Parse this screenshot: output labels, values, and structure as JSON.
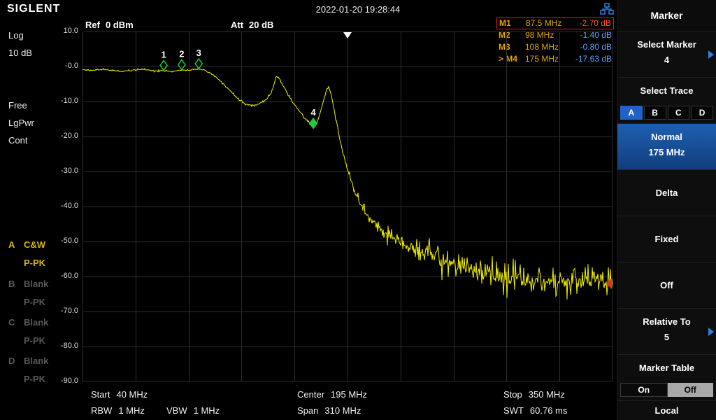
{
  "header": {
    "logo": "SIGLENT",
    "datetime": "2022-01-20 19:28:44"
  },
  "top_info": {
    "ref_label": "Ref",
    "ref_value": "0 dBm",
    "att_label": "Att",
    "att_value": "20 dB"
  },
  "marker_table": {
    "rows": [
      {
        "id": "M1",
        "freq": "87.5 MHz",
        "amp": "-2.70 dB",
        "highlight": true
      },
      {
        "id": "M2",
        "freq": "98 MHz",
        "amp": "-1.40 dB",
        "highlight": false
      },
      {
        "id": "M3",
        "freq": "108 MHz",
        "amp": "-0.80 dB",
        "highlight": false
      },
      {
        "id": "> M4",
        "freq": "175 MHz",
        "amp": "-17.63 dB",
        "highlight": false
      }
    ]
  },
  "left_panel": {
    "log": "Log",
    "scale": "10 dB",
    "free": "Free",
    "lgpwr": "LgPwr",
    "cont": "Cont",
    "traces": [
      {
        "id": "A",
        "mode": "C&W",
        "det": "P-PK",
        "active": true
      },
      {
        "id": "B",
        "mode": "Blank",
        "det": "P-PK",
        "active": false
      },
      {
        "id": "C",
        "mode": "Blank",
        "det": "P-PK",
        "active": false
      },
      {
        "id": "D",
        "mode": "Blank",
        "det": "P-PK",
        "active": false
      }
    ]
  },
  "footer": {
    "start": {
      "label": "Start",
      "value": "40 MHz"
    },
    "center": {
      "label": "Center",
      "value": "195 MHz"
    },
    "stop": {
      "label": "Stop",
      "value": "350 MHz"
    },
    "rbw": {
      "label": "RBW",
      "value": "1 MHz"
    },
    "vbw": {
      "label": "VBW",
      "value": "1 MHz"
    },
    "span": {
      "label": "Span",
      "value": "310 MHz"
    },
    "swt": {
      "label": "SWT",
      "value": "60.76 ms"
    }
  },
  "menu": {
    "title": "Marker",
    "select_marker": {
      "label": "Select Marker",
      "value": "4"
    },
    "select_trace": {
      "label": "Select Trace",
      "tabs": [
        "A",
        "B",
        "C",
        "D"
      ],
      "active": "A"
    },
    "normal": {
      "label": "Normal",
      "value": "175 MHz"
    },
    "delta": "Delta",
    "fixed": "Fixed",
    "off": "Off",
    "relative_to": {
      "label": "Relative To",
      "value": "5"
    },
    "marker_table": {
      "label": "Marker Table",
      "on": "On",
      "off": "Off",
      "state": "Off"
    },
    "local": "Local"
  },
  "colors": {
    "accent_blue": "#2f7fe0",
    "menu_blue": "#1d5fb2",
    "trace_yellow": "#f0f000",
    "marker_green": "#1ecc3c",
    "alert_red": "#d81f14",
    "label_yellow": "#e0a300"
  },
  "chart_data": {
    "type": "line",
    "title": "Spectrum trace A",
    "x_unit": "MHz",
    "y_unit": "dBm",
    "x_range": [
      40,
      350
    ],
    "y_range": [
      -90,
      10
    ],
    "ref_level_dbm": 0,
    "scale_db_per_div": 10,
    "y_tick_labels": [
      "10.0",
      "-0.0",
      "-10.0",
      "-20.0",
      "-30.0",
      "-40.0",
      "-50.0",
      "-60.0",
      "-70.0",
      "-80.0",
      "-90.0"
    ],
    "trace_color": "#f0f000",
    "grid_color": "#2d2d2d",
    "marker_color": "#1ecc3c",
    "noise_seed": 1234567,
    "center_indicator_freq": 195,
    "edge_marker_db": -62,
    "keypoints": [
      [
        40,
        -0.9
      ],
      [
        46,
        -1.1
      ],
      [
        52,
        -0.8
      ],
      [
        58,
        -1.2
      ],
      [
        64,
        -1.4
      ],
      [
        70,
        -1.0
      ],
      [
        76,
        -0.8
      ],
      [
        82,
        -1.3
      ],
      [
        87.5,
        -1.1
      ],
      [
        92,
        -1.5
      ],
      [
        98,
        -0.9
      ],
      [
        103,
        -1.1
      ],
      [
        108,
        -0.6
      ],
      [
        112,
        -1.2
      ],
      [
        117,
        -2.6
      ],
      [
        122,
        -4.8
      ],
      [
        127,
        -7.2
      ],
      [
        131,
        -9.2
      ],
      [
        135,
        -10.6
      ],
      [
        139,
        -11.2
      ],
      [
        143,
        -10.8
      ],
      [
        147,
        -9.6
      ],
      [
        150,
        -7.8
      ],
      [
        152,
        -5.2
      ],
      [
        153.5,
        -2.8
      ],
      [
        155,
        -3.4
      ],
      [
        157,
        -5.2
      ],
      [
        160,
        -7.8
      ],
      [
        163,
        -10.2
      ],
      [
        166,
        -12.2
      ],
      [
        169,
        -14.0
      ],
      [
        172,
        -15.8
      ],
      [
        175,
        -17.6
      ],
      [
        177,
        -16.4
      ],
      [
        179,
        -13.2
      ],
      [
        181,
        -9.6
      ],
      [
        183,
        -6.4
      ],
      [
        184,
        -5.6
      ],
      [
        185,
        -7.2
      ],
      [
        186.5,
        -10.5
      ],
      [
        188,
        -14.5
      ],
      [
        190,
        -19.5
      ],
      [
        192,
        -24.0
      ],
      [
        195,
        -29.5
      ],
      [
        198,
        -34.0
      ],
      [
        201,
        -38.0
      ],
      [
        205,
        -41.5
      ],
      [
        209,
        -44.0
      ],
      [
        214,
        -46.5
      ],
      [
        220,
        -48.5
      ],
      [
        227,
        -50.5
      ],
      [
        234,
        -52.0
      ],
      [
        242,
        -53.5
      ],
      [
        250,
        -55.0
      ],
      [
        258,
        -56.5
      ],
      [
        267,
        -58.0
      ],
      [
        277,
        -59.5
      ],
      [
        288,
        -60.5
      ],
      [
        300,
        -61.0
      ],
      [
        315,
        -61.5
      ],
      [
        330,
        -61.5
      ],
      [
        350,
        -61.5
      ]
    ],
    "noise_segments": [
      [
        40,
        112,
        0.18
      ],
      [
        112,
        150,
        0.28
      ],
      [
        150,
        178,
        0.3
      ],
      [
        178,
        188,
        0.3
      ],
      [
        188,
        200,
        0.7
      ],
      [
        200,
        215,
        1.3
      ],
      [
        215,
        235,
        2.0
      ],
      [
        235,
        351,
        3.4
      ]
    ],
    "markers": [
      {
        "n": "1",
        "freq": 87.5,
        "db": -1.1,
        "filled": false
      },
      {
        "n": "2",
        "freq": 98,
        "db": -0.9,
        "filled": false
      },
      {
        "n": "3",
        "freq": 108,
        "db": -0.6,
        "filled": false
      },
      {
        "n": "4",
        "freq": 175,
        "db": -17.63,
        "filled": true
      }
    ]
  }
}
